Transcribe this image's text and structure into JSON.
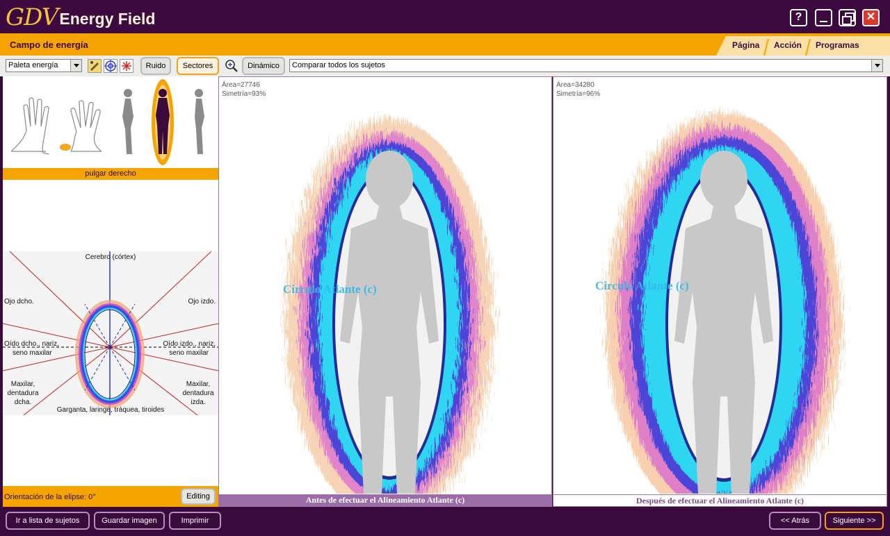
{
  "window": {
    "logo_mark": "GDV",
    "logo_text": "Energy Field",
    "help_glyph": "?",
    "close_glyph": "✕"
  },
  "header": {
    "title": "Campo de energía",
    "menu": [
      "Página",
      "Acción",
      "Programas"
    ]
  },
  "toolbar": {
    "palette_value": "Paleta energía",
    "ruido_label": "Ruido",
    "sectores_label": "Sectores",
    "dinamico_label": "Dinámico",
    "compare_value": "Comparar todos los sujetos"
  },
  "left_panel": {
    "thumbnails": [
      "left-hand",
      "right-hand",
      "body-side",
      "body-front",
      "body-side-right"
    ],
    "selected_thumbnail": "body-front",
    "selected_label": "pulgar derecho",
    "sectors": {
      "top": "Cerebro (córtex)",
      "right_eye": "Ojo dcho.",
      "left_eye": "Ojo izdo.",
      "right_ear_1": "Oído dcho., nariz,",
      "right_ear_2": "seno maxilar",
      "left_ear_1": "Oído izdo., nariz,",
      "left_ear_2": "seno maxilar",
      "right_jaw_1": "Maxilar,",
      "right_jaw_2": "dentadura",
      "right_jaw_3": "dcha.",
      "left_jaw_1": "Maxilar,",
      "left_jaw_2": "dentadura",
      "left_jaw_3": "izda.",
      "bottom": "Garganta, laringe, tráquea, tiroides"
    },
    "orientation_label": "Orientación de la elipse: 0°",
    "editing_label": "Editing"
  },
  "panels": [
    {
      "area": "Área=27746",
      "symmetry": "Simetría=93%",
      "watermark": "Circulo Atlante (c)",
      "caption": "Antes de efectuar el Alineamiento Atlante (c)"
    },
    {
      "area": "Área=34280",
      "symmetry": "Simetría=96%",
      "watermark": "Circulo Atlante (c)",
      "caption": "Después de efectuar el Alineamiento Atlante (c)"
    }
  ],
  "bottom": {
    "list_label": "Ir a lista de sujetos",
    "save_label": "Guardar imagen",
    "print_label": "Imprimir",
    "back_label": "<< Atrás",
    "next_label": "Siguiente >>"
  },
  "colors": {
    "brand_purple": "#3a0a3c",
    "accent_orange": "#f6a400",
    "aura_cyan": "#2fd6f2",
    "aura_blue": "#3a4fe0",
    "aura_magenta": "#c24fd8",
    "aura_orange": "#f0a070"
  }
}
